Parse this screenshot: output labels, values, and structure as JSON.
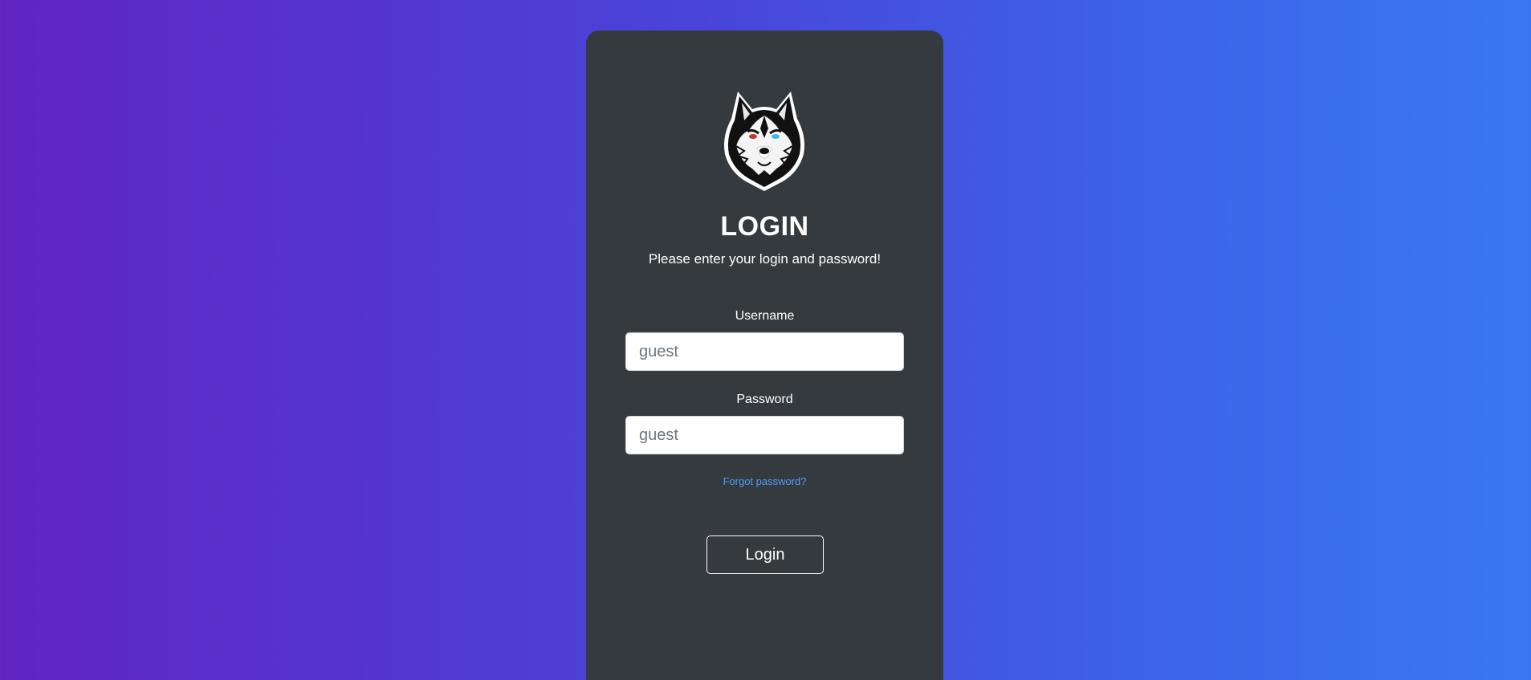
{
  "login": {
    "logo_icon": "wolf-head-logo",
    "title": "LOGIN",
    "subtitle": "Please enter your login and password!",
    "username": {
      "label": "Username",
      "placeholder": "guest",
      "value": ""
    },
    "password": {
      "label": "Password",
      "placeholder": "guest",
      "value": ""
    },
    "forgot_password": "Forgot password?",
    "submit_label": "Login"
  },
  "colors": {
    "background_start": "#6125c4",
    "background_end": "#3a78f2",
    "card": "#353a3f",
    "link": "#4d9cf8",
    "text": "#ffffff"
  }
}
